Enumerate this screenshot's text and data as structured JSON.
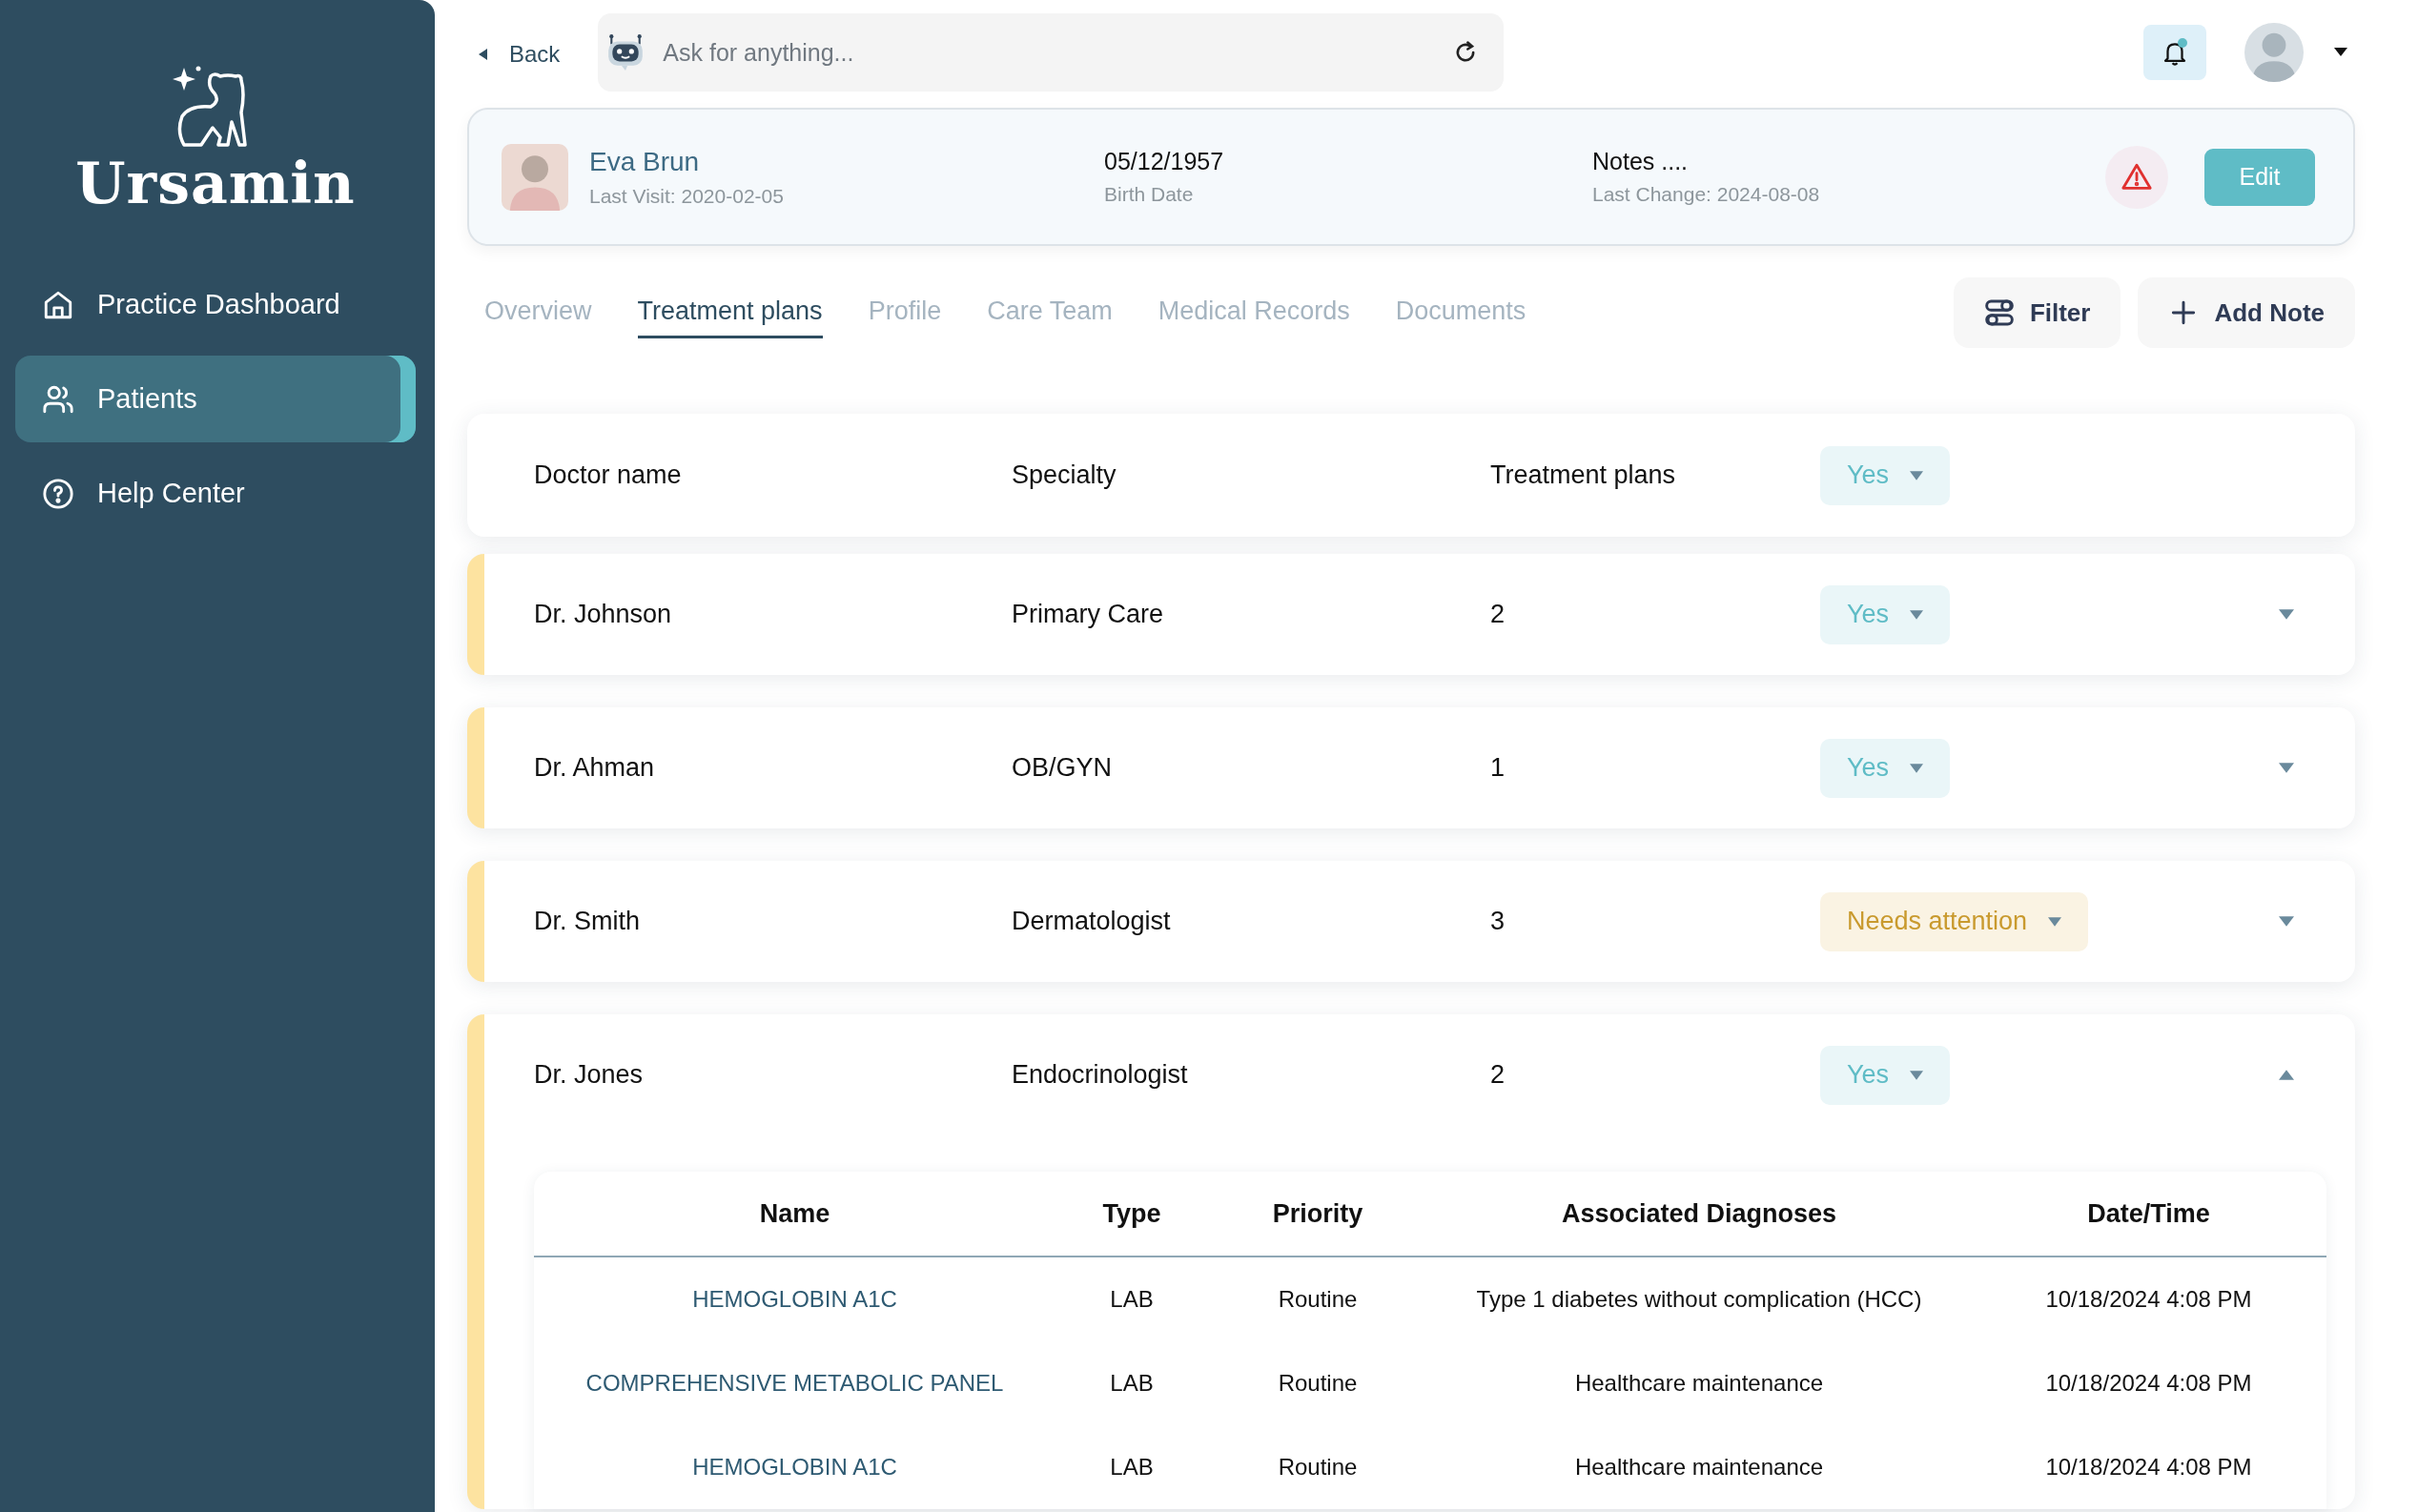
{
  "sidebar": {
    "logo": "Ursamin",
    "items": [
      {
        "label": "Practice Dashboard",
        "selected": false
      },
      {
        "label": "Patients",
        "selected": true
      },
      {
        "label": "Help Center",
        "selected": false
      }
    ]
  },
  "topbar": {
    "back": "Back",
    "search": {
      "placeholder": "Ask for anything..."
    },
    "notifications": {
      "unread": true
    }
  },
  "patient": {
    "name": "Eva Brun",
    "last_visit": "Last Visit: 2020-02-05",
    "birth_date": "05/12/1957",
    "birth_date_label": "Birth Date",
    "notes": "Notes ....",
    "notes_change": "Last Change: 2024-08-08",
    "alert": true,
    "edit": "Edit"
  },
  "tabs": [
    {
      "label": "Overview",
      "selected": false
    },
    {
      "label": "Treatment plans",
      "selected": true
    },
    {
      "label": "Profile",
      "selected": false
    },
    {
      "label": "Care Team",
      "selected": false
    },
    {
      "label": "Medical Records",
      "selected": false
    },
    {
      "label": "Documents",
      "selected": false
    }
  ],
  "actions": {
    "filter": "Filter",
    "add_note": "Add Note"
  },
  "table": {
    "columns": [
      "Doctor name",
      "Specialty",
      "Treatment plans"
    ],
    "header_status": {
      "label": "Yes",
      "kind": "yes"
    },
    "rows": [
      {
        "doctor": "Dr. Johnson",
        "specialty": "Primary Care",
        "plans": "2",
        "status": {
          "label": "Yes",
          "kind": "yes"
        },
        "expanded": false
      },
      {
        "doctor": "Dr. Ahman",
        "specialty": "OB/GYN",
        "plans": "1",
        "status": {
          "label": "Yes",
          "kind": "yes"
        },
        "expanded": false
      },
      {
        "doctor": "Dr. Smith",
        "specialty": "Dermatologist",
        "plans": "3",
        "status": {
          "label": "Needs attention",
          "kind": "attention"
        },
        "expanded": false
      },
      {
        "doctor": "Dr. Jones",
        "specialty": "Endocrinologist",
        "plans": "2",
        "status": {
          "label": "Yes",
          "kind": "yes"
        },
        "expanded": true,
        "details": {
          "columns": [
            "Name",
            "Type",
            "Priority",
            "Associated Diagnoses",
            "Date/Time"
          ],
          "rows": [
            [
              "HEMOGLOBIN A1C",
              "LAB",
              "Routine",
              "Type 1 diabetes without complication (HCC)",
              "10/18/2024 4:08 PM"
            ],
            [
              "COMPREHENSIVE METABOLIC PANEL",
              "LAB",
              "Routine",
              "Healthcare maintenance",
              "10/18/2024 4:08 PM"
            ],
            [
              "HEMOGLOBIN A1C",
              "LAB",
              "Routine",
              "Healthcare maintenance",
              "10/18/2024 4:08 PM"
            ]
          ]
        }
      }
    ]
  }
}
